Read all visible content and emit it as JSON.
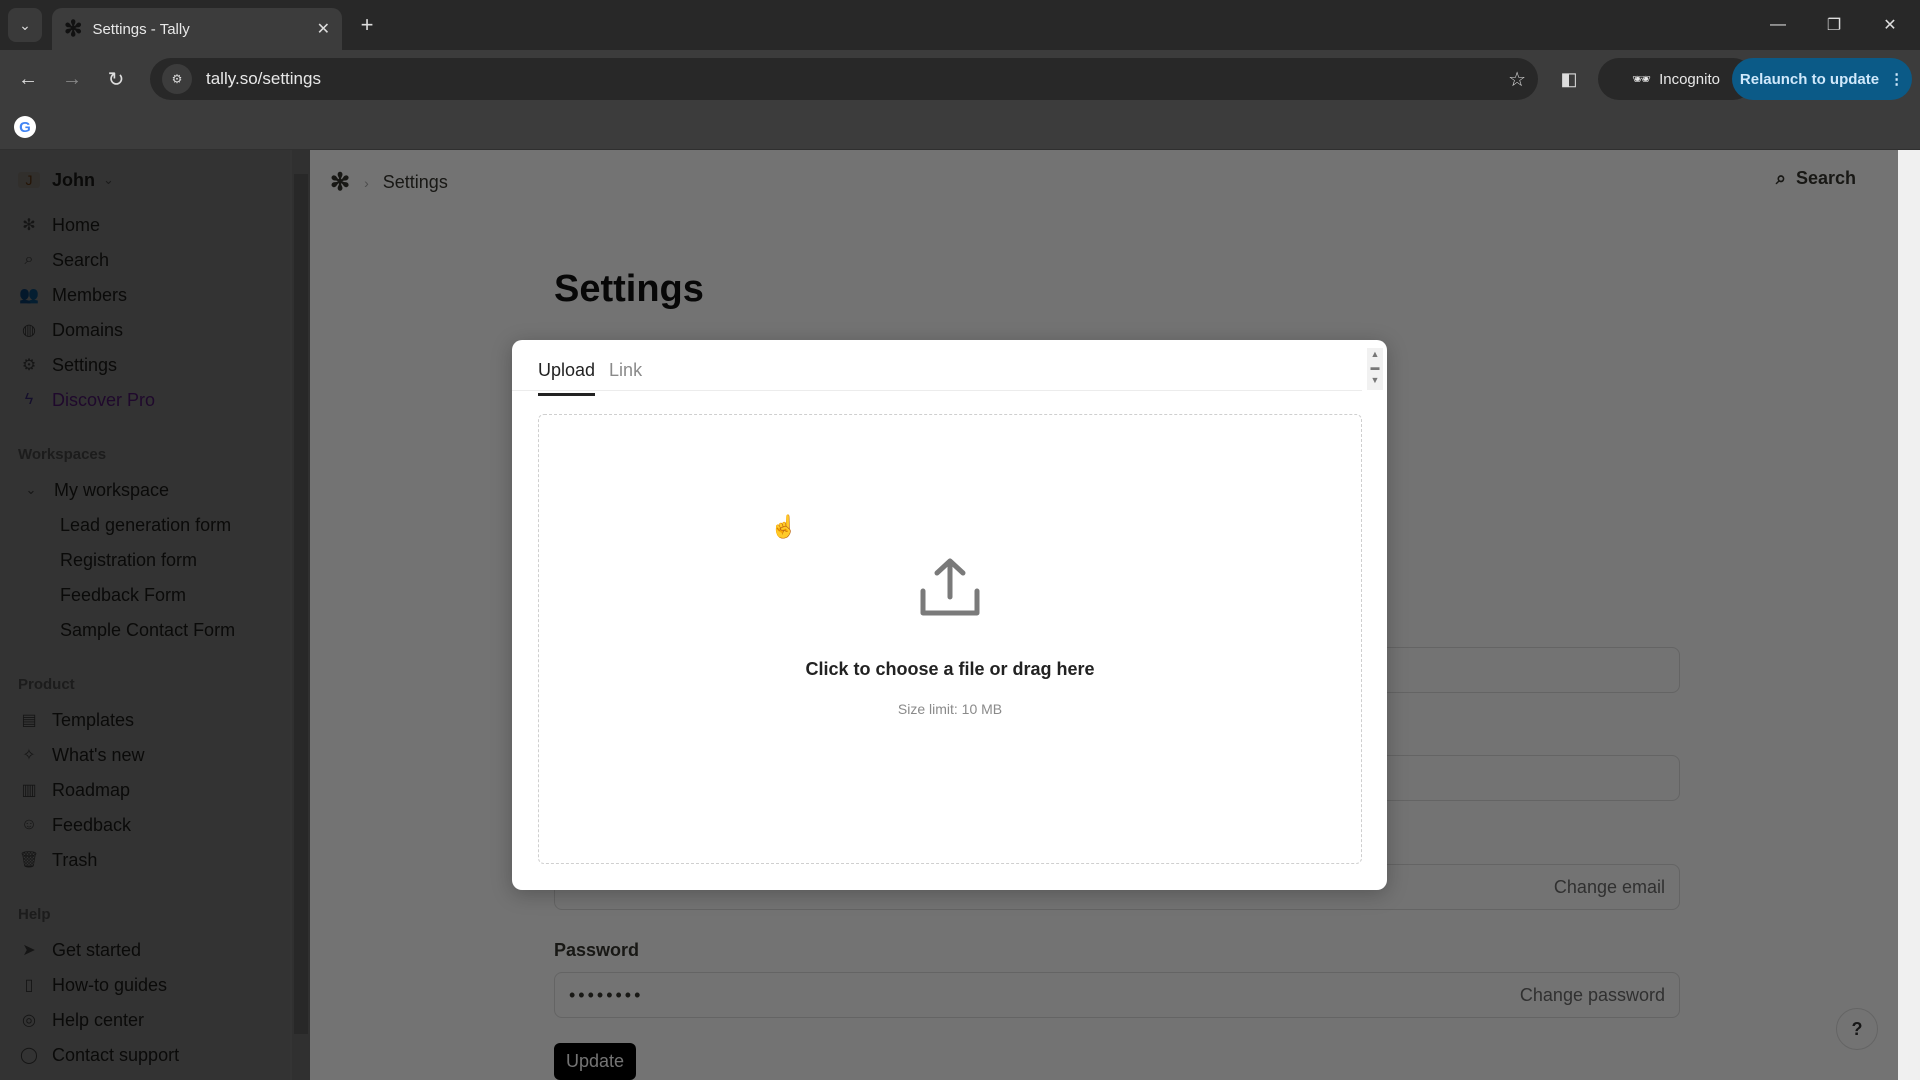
{
  "browser": {
    "tab_title": "Settings - Tally",
    "url": "tally.so/settings",
    "incognito_label": "Incognito",
    "relaunch_label": "Relaunch to update"
  },
  "sidebar": {
    "user": {
      "initial": "J",
      "name": "John"
    },
    "nav": [
      {
        "label": "Home",
        "icon": "tally-asterisk-icon"
      },
      {
        "label": "Search",
        "icon": "search-icon"
      },
      {
        "label": "Members",
        "icon": "users-icon"
      },
      {
        "label": "Domains",
        "icon": "globe-icon"
      },
      {
        "label": "Settings",
        "icon": "gear-icon"
      },
      {
        "label": "Discover Pro",
        "icon": "lightning-icon"
      }
    ],
    "workspaces_heading": "Workspaces",
    "workspace_name": "My workspace",
    "forms": [
      "Lead generation form",
      "Registration form",
      "Feedback Form",
      "Sample Contact Form"
    ],
    "product_heading": "Product",
    "product": [
      {
        "label": "Templates",
        "icon": "templates-icon"
      },
      {
        "label": "What's new",
        "icon": "sparkle-icon"
      },
      {
        "label": "Roadmap",
        "icon": "map-icon"
      },
      {
        "label": "Feedback",
        "icon": "smiley-icon"
      },
      {
        "label": "Trash",
        "icon": "trash-icon"
      }
    ],
    "help_heading": "Help",
    "help": [
      {
        "label": "Get started",
        "icon": "send-icon"
      },
      {
        "label": "How-to guides",
        "icon": "book-icon"
      },
      {
        "label": "Help center",
        "icon": "lifebuoy-icon"
      },
      {
        "label": "Contact support",
        "icon": "chat-icon"
      }
    ]
  },
  "main": {
    "breadcrumb": "Settings",
    "search_label": "Search",
    "title": "Settings",
    "email_action": "Change email",
    "password_label": "Password",
    "password_value": "••••••••",
    "password_action": "Change password",
    "update_label": "Update",
    "help_label": "?"
  },
  "modal": {
    "tabs": [
      "Upload",
      "Link"
    ],
    "active_tab": "Upload",
    "drop_text": "Click to choose a file or drag here",
    "size_limit": "Size limit: 10 MB"
  },
  "colors": {
    "accent_pro": "#9b30d9",
    "relaunch_bg": "#0b5a87"
  }
}
